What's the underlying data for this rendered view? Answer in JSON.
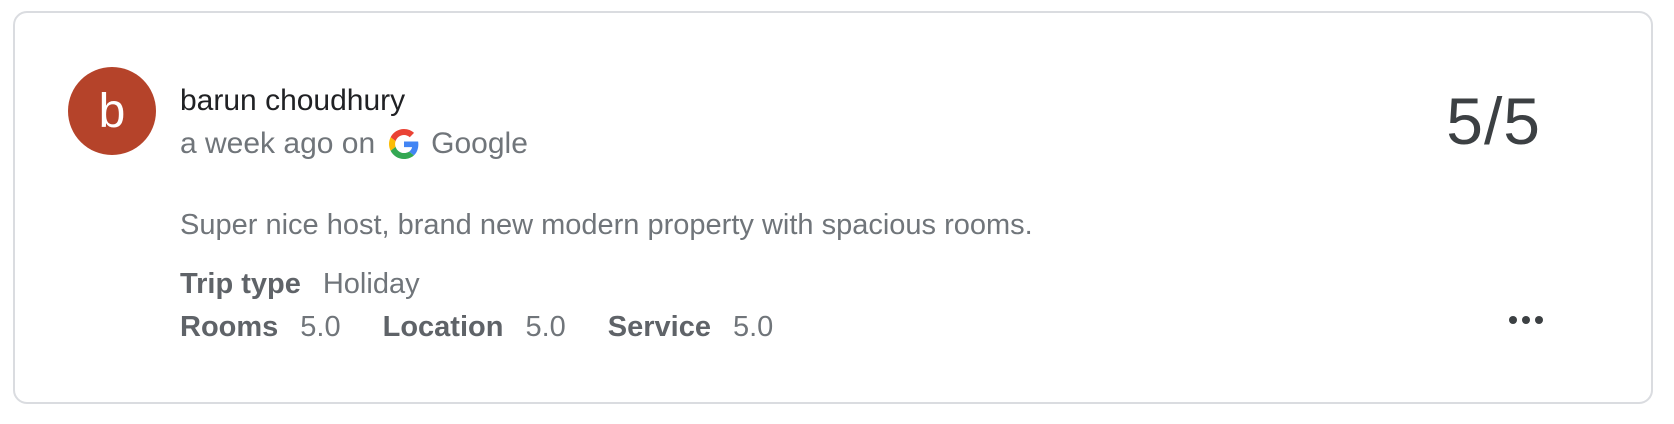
{
  "review": {
    "avatar_letter": "b",
    "avatar_color": "#b5432a",
    "author": "barun choudhury",
    "time_ago": "a week ago on",
    "source_icon": "google-g-icon",
    "source": "Google",
    "score": "5/5",
    "text": "Super nice host, brand new modern property with spacious rooms.",
    "trip_type_label": "Trip type",
    "trip_type_value": "Holiday",
    "ratings": [
      {
        "label": "Rooms",
        "value": "5.0"
      },
      {
        "label": "Location",
        "value": "5.0"
      },
      {
        "label": "Service",
        "value": "5.0"
      }
    ],
    "more_icon": "more-horizontal-icon"
  }
}
